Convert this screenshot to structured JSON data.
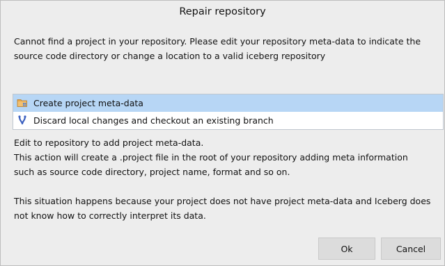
{
  "dialog": {
    "title": "Repair repository",
    "message": [
      "Cannot find a project in your repository. Please edit your repository meta-data to indicate the",
      "source code directory or change a location to a valid iceberg repository"
    ]
  },
  "options": [
    {
      "label": "Create project meta-data",
      "icon": "folder-icon",
      "selected": true
    },
    {
      "label": "Discard local changes and checkout an existing branch",
      "icon": "branch-icon",
      "selected": false
    }
  ],
  "help": {
    "line1": "Edit to repository to add project meta-data.",
    "line2": "This action will create a .project file in the root of your repository adding meta information",
    "line3": "such as source code directory, project name, format and so on.",
    "line4": "This situation happens because your project does not have project meta-data and Iceberg does",
    "line5": "not know how to correctly interpret its data."
  },
  "buttons": {
    "ok": "Ok",
    "cancel": "Cancel"
  },
  "colors": {
    "selection": "#b7d6f5",
    "background": "#ededed",
    "branch_icon": "#3a5fbf",
    "folder_icon": "#e0a040"
  }
}
